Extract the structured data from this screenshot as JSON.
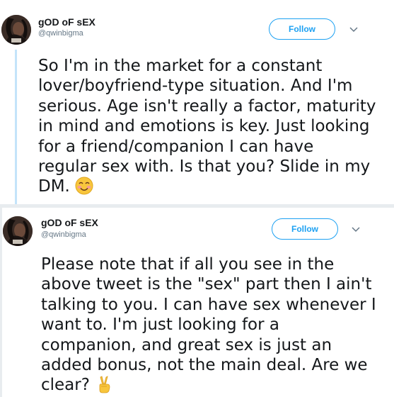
{
  "tweets": [
    {
      "display_name": "gOD oF sEX",
      "handle": "@qwinbigma",
      "follow_label": "Follow",
      "lines": [
        "So I'm in the market for a constant",
        "lover/boyfriend-type situation. And I'm",
        "serious. Age isn't really a factor, maturity",
        "in mind and emotions is key. Just looking",
        "for a friend/companion I can have",
        "regular sex with. Is that you? Slide in my",
        "DM."
      ],
      "emoji": "smiling-face-with-heart-eyes"
    },
    {
      "display_name": "gOD oF sEX",
      "handle": "@qwinbigma",
      "follow_label": "Follow",
      "lines": [
        "Please note that if all you see in the",
        "above tweet is the \"sex\" part then I ain't",
        "talking to you. I can have sex whenever I",
        "want to. I'm just looking for a",
        "companion, and great sex is just an",
        "added bonus, not the main deal. Are we",
        "clear?"
      ],
      "emoji": "victory-hand"
    }
  ],
  "colors": {
    "accent": "#1da1f2",
    "text": "#14171a",
    "muted": "#657786",
    "thread_line": "#c4e4fa",
    "background": "#e8ecef"
  }
}
